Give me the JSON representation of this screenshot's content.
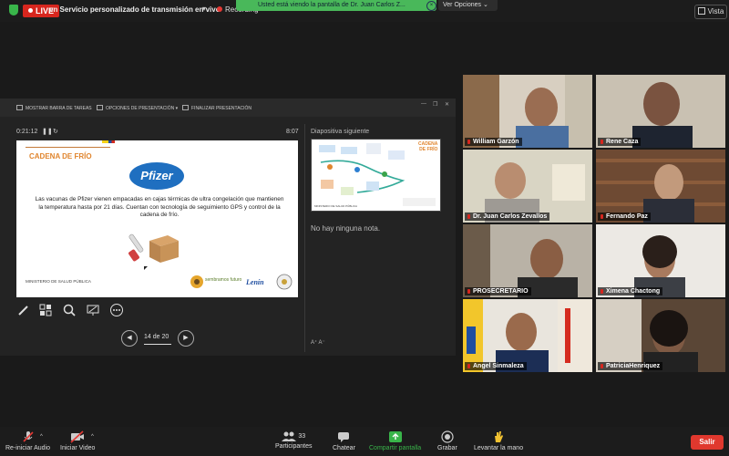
{
  "topbar": {
    "live_label": "LIVE",
    "stream_title": "en Servicio personalizado de transmisión en vivo",
    "recording_label": "Recording",
    "share_banner": "Usted está viendo la pantalla de Dr. Juan Carlos Z...",
    "view_options": "Ver Opciones",
    "view_options_caret": "⌄",
    "view_button": "Vista",
    "live_color": "#d7261e",
    "banner_color": "#49b85a"
  },
  "presenter": {
    "toolbar": [
      "MOSTRAR BARRA DE TAREAS",
      "OPCIONES DE PRESENTACIÓN ▾",
      "FINALIZAR PRESENTACIÓN"
    ],
    "elapsed": "0:21:12",
    "clock": "8:07",
    "next_slide_label": "Diapositiva siguiente",
    "notes_text": "No hay ninguna nota.",
    "font_controls": "A⁺  A⁻",
    "page_indicator": "14 de 20",
    "tools": [
      "pen-icon",
      "slides-grid-icon",
      "zoom-icon",
      "laser-icon",
      "more-icon"
    ]
  },
  "slide": {
    "title": "CADENA DE FRÍO",
    "brand": "Pfizer",
    "body": "Las vacunas de Pfizer vienen empacadas en cajas térmicas de ultra congelación que mantienen la temperatura hasta por 21 días. Cuentan con tecnología de seguimiento GPS y control de la cadena de frío.",
    "ministerio": "MINISTERIO DE SALUD PÚBLICA",
    "logo_1": "sembramos futuro",
    "logo_2": "Lenín",
    "accent": "#e0852e"
  },
  "next_slide": {
    "title_line1": "CADENA",
    "title_line2": "DE FRÍO",
    "footer": "MINISTERIO DE SALUD PÚBLICA"
  },
  "participants": [
    {
      "name": "William Garzón"
    },
    {
      "name": "Rene Caza"
    },
    {
      "name": "Dr. Juan Carlos Zevallos",
      "active": true
    },
    {
      "name": "Fernando Paz"
    },
    {
      "name": "PROSECRETARIO"
    },
    {
      "name": "Ximena Chactong"
    },
    {
      "name": "Angel Sinmaleza"
    },
    {
      "name": "PatriciaHenriquez"
    }
  ],
  "bottombar": {
    "audio": "Re-iniciar Audio",
    "video": "Iniciar Video",
    "participants": "Participantes",
    "participant_count": "33",
    "chat": "Chatear",
    "share": "Compartir pantalla",
    "record": "Grabar",
    "raise_hand": "Levantar la mano",
    "leave": "Salir",
    "share_color": "#39b54a",
    "leave_color": "#e0382e"
  }
}
